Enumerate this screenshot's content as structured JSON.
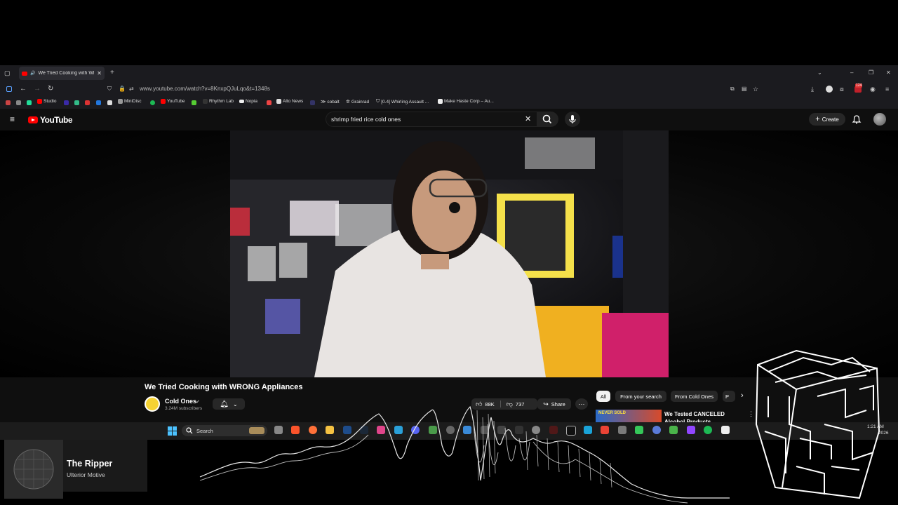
{
  "browser": {
    "tab_title": "We Tried Cooking with WR",
    "url": "www.youtube.com/watch?v=8KnxpQJuLqo&t=1348s",
    "bookmarks": [
      "Studio",
      "MiniDisc",
      "YouTube",
      "Rhythm Lab",
      "Nopia",
      "Alto News",
      "cobalt",
      "Grainrad",
      "[0.4] Whirling Assault ...",
      "Make Haste Corp – Au..."
    ],
    "extension_badge": "124"
  },
  "youtube": {
    "logo": "YouTube",
    "search_value": "shrimp fried rice cold ones",
    "create_label": "Create"
  },
  "video": {
    "title": "We Tried Cooking with WRONG Appliances",
    "channel": "Cold Ones",
    "subscribers": "3.24M subscribers",
    "likes": "88K",
    "dislikes": "737",
    "share_label": "Share"
  },
  "chips": [
    "All",
    "From your search",
    "From Cold Ones",
    "P"
  ],
  "recommended": {
    "title": "We Tested CANCELED Alcohol Products",
    "thumb_text": "NEVER SOLD"
  },
  "taskbar": {
    "search_label": "Search",
    "clock_time": "1:21 AM",
    "clock_date": "2026"
  },
  "now_playing": {
    "title": "The Ripper",
    "artist": "Ulterior Motive"
  }
}
